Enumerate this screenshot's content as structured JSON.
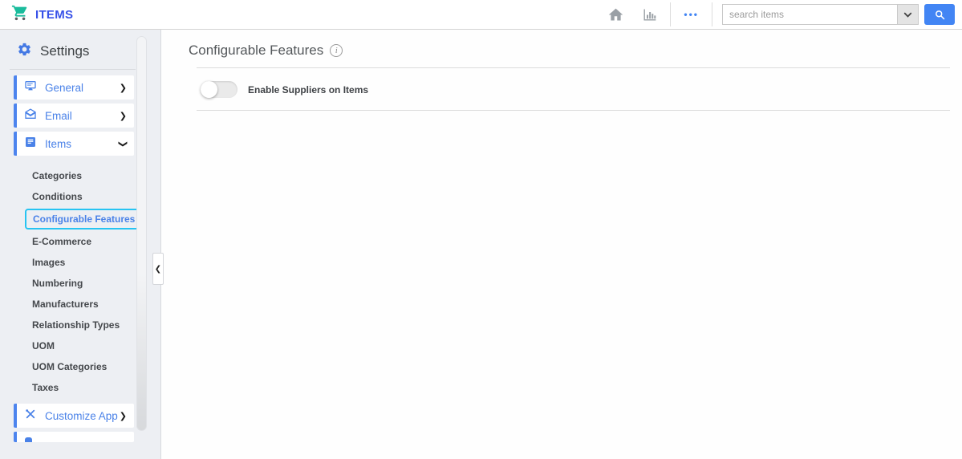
{
  "header": {
    "app_title": "ITEMS",
    "search_placeholder": "search items"
  },
  "glyphs": {
    "chevron_right": "❯",
    "chevron_left": "❮",
    "ellipsis": "•••",
    "info": "i"
  },
  "sidebar": {
    "title": "Settings",
    "sections": [
      {
        "label": "General",
        "icon": "monitor-icon",
        "state": "collapsed"
      },
      {
        "label": "Email",
        "icon": "envelope-icon",
        "state": "collapsed"
      },
      {
        "label": "Items",
        "icon": "list-icon",
        "state": "expanded"
      }
    ],
    "submenu": [
      "Categories",
      "Conditions",
      "Configurable Features",
      "E-Commerce",
      "Images",
      "Numbering",
      "Manufacturers",
      "Relationship Types",
      "UOM",
      "UOM Categories",
      "Taxes"
    ],
    "selected_submenu": "Configurable Features",
    "customize": {
      "label": "Customize App",
      "icon": "tools-icon"
    }
  },
  "main": {
    "title": "Configurable Features",
    "toggle_label": "Enable Suppliers on Items",
    "toggle_state": "off"
  },
  "colors": {
    "accent_blue": "#4285f4",
    "menu_blue": "#4a82e8",
    "logo_teal": "#1abc9c",
    "highlight_cyan": "#27c4f2",
    "sidebar_bg": "#edeff3"
  }
}
